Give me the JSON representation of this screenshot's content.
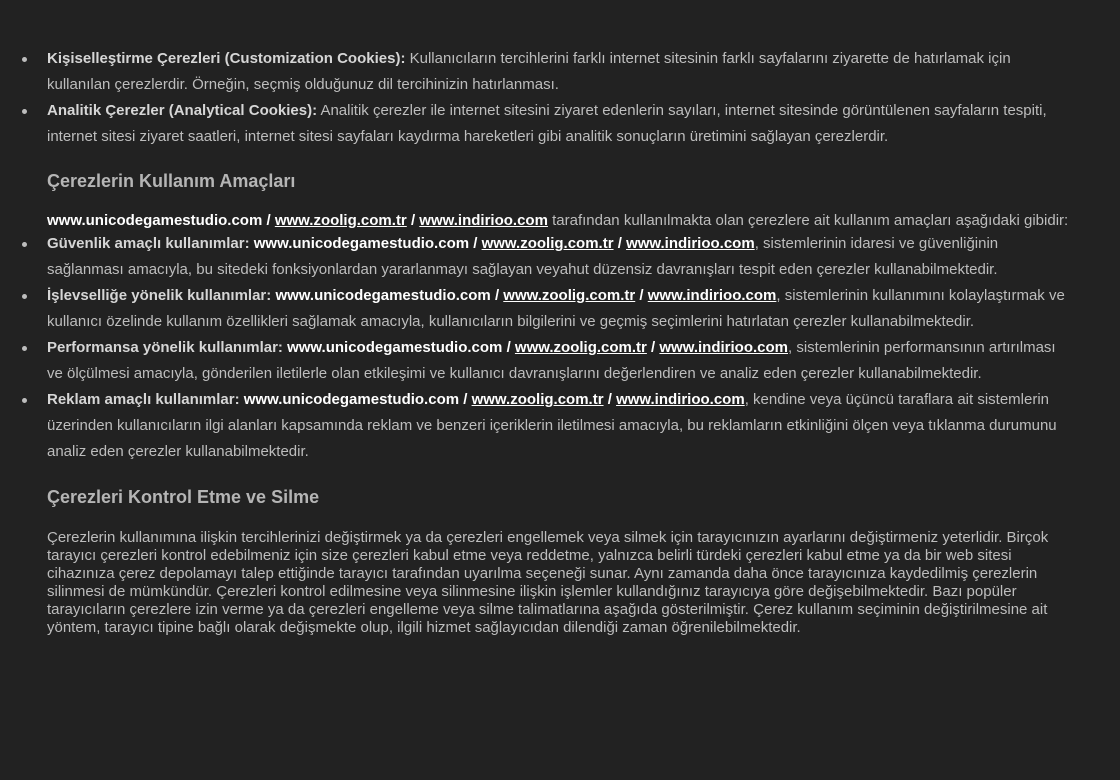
{
  "colors": {
    "background": "#222222",
    "text": "#bdbdbd",
    "heading": "#b5b5b5",
    "link": "#ffffff"
  },
  "list1": [
    {
      "label": "Kişiselleştirme Çerezleri (Customization Cookies):",
      "text": "Kullanıcıların tercihlerini farklı internet sitesinin farklı sayfalarını ziyarette de hatırlamak için kullanılan çerezlerdir. Örneğin, seçmiş olduğunuz dil tercihinizin hatırlanması."
    },
    {
      "label": "Analitik Çerezler (Analytical Cookies):",
      "text": "Analitik çerezler ile internet sitesini ziyaret edenlerin sayıları, internet sitesinde görüntülenen sayfaların tespiti, internet sitesi ziyaret saatleri, internet sitesi sayfaları kaydırma hareketleri gibi analitik sonuçların üretimini sağlayan çerezlerdir."
    }
  ],
  "section1": {
    "heading": "Çerezlerin Kullanım Amaçları",
    "intro_site": "www.unicodegamestudio.com",
    "sep": "/",
    "link1": "www.zoolig.com.tr",
    "link2": "www.indirioo.com",
    "intro_text": "tarafından kullanılmakta olan çerezlere ait kullanım amaçları aşağıdaki gibidir:"
  },
  "list2": [
    {
      "label": "Güvenlik amaçlı kullanımlar:",
      "site": "www.unicodegamestudio.com",
      "link1": "www.zoolig.com.tr",
      "link2": "www.indirioo.com",
      "text": ", sistemlerinin idaresi ve güvenliğinin sağlanması amacıyla, bu sitedeki fonksiyonlardan yararlanmayı sağlayan veyahut düzensiz davranışları tespit eden çerezler kullanabilmektedir."
    },
    {
      "label": "İşlevselliğe yönelik kullanımlar:",
      "site": "www.unicodegamestudio.com",
      "link1": "www.zoolig.com.tr",
      "link2": "www.indirioo.com",
      "text": ", sistemlerinin kullanımını kolaylaştırmak ve kullanıcı özelinde kullanım özellikleri sağlamak amacıyla, kullanıcıların bilgilerini ve geçmiş seçimlerini hatırlatan çerezler kullanabilmektedir."
    },
    {
      "label": "Performansa yönelik kullanımlar:",
      "site": "www.unicodegamestudio.com",
      "link1": "www.zoolig.com.tr",
      "link2": "www.indirioo.com",
      "text": ", sistemlerinin performansının artırılması ve ölçülmesi amacıyla, gönderilen iletilerle olan etkileşimi ve kullanıcı davranışlarını değerlendiren ve analiz eden çerezler kullanabilmektedir."
    },
    {
      "label": "Reklam amaçlı kullanımlar:",
      "site": "www.unicodegamestudio.com",
      "link1": "www.zoolig.com.tr",
      "link2": "www.indirioo.com",
      "text": ", kendine veya üçüncü taraflara ait sistemlerin üzerinden kullanıcıların ilgi alanları kapsamında reklam ve benzeri içeriklerin iletilmesi amacıyla, bu reklamların etkinliğini ölçen veya tıklanma durumunu analiz eden çerezler kullanabilmektedir."
    }
  ],
  "section2": {
    "heading": "Çerezleri Kontrol Etme ve Silme",
    "paragraph": "Çerezlerin kullanımına ilişkin tercihlerinizi değiştirmek ya da çerezleri engellemek veya silmek için tarayıcınızın ayarlarını değiştirmeniz yeterlidir. Birçok tarayıcı çerezleri kontrol edebilmeniz için size çerezleri kabul etme veya reddetme, yalnızca belirli türdeki çerezleri kabul etme ya da bir web sitesi cihazınıza çerez depolamayı talep ettiğinde tarayıcı tarafından uyarılma seçeneği sunar. Aynı zamanda daha önce tarayıcınıza kaydedilmiş çerezlerin silinmesi de mümkündür. Çerezleri kontrol edilmesine veya silinmesine ilişkin işlemler kullandığınız tarayıcıya göre değişebilmektedir. Bazı popüler tarayıcıların çerezlere izin verme ya da çerezleri engelleme veya silme talimatlarına aşağıda gösterilmiştir. Çerez kullanım seçiminin değiştirilmesine ait yöntem, tarayıcı tipine bağlı olarak değişmekte olup, ilgili hizmet sağlayıcıdan dilendiği zaman öğrenilebilmektedir."
  }
}
